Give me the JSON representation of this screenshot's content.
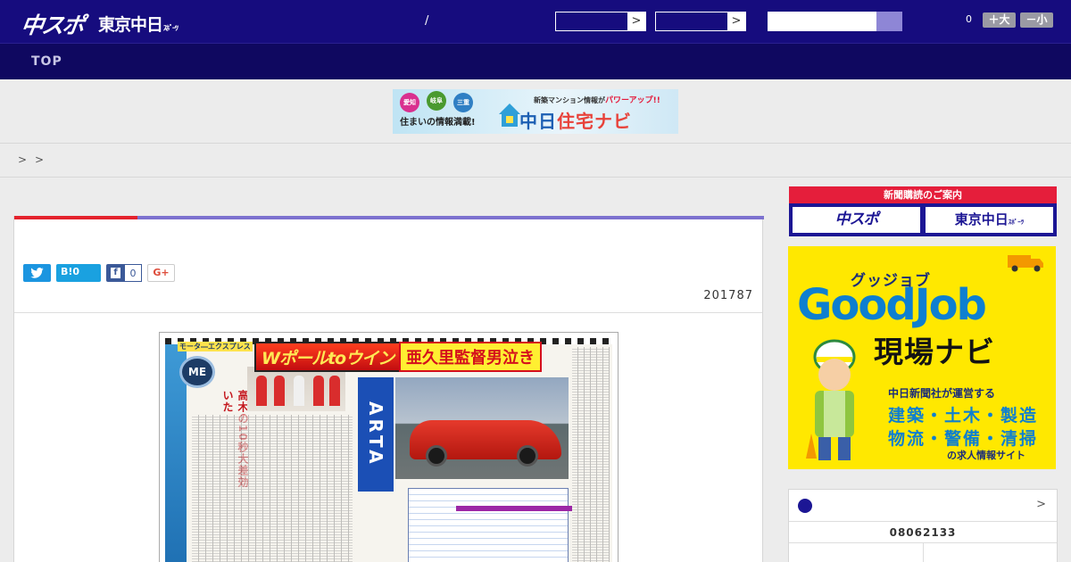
{
  "header": {
    "logo_chuspo": "中スポ",
    "logo_tokyo": "東京中日",
    "logo_tokyo_small": "ｽﾎﾟｰﾂ",
    "slash": "/",
    "select_arrow": ">",
    "font_size_count": "0",
    "size_up_label": "＋大",
    "size_down_label": "－小"
  },
  "nav": {
    "top_label": "TOP"
  },
  "banner": {
    "tag_1": "愛知",
    "tag_2": "岐阜",
    "tag_3": "三重",
    "subtext": "住まいの情報満載!",
    "headline": "新築マンション情報が",
    "headline_accent": "パワーアップ!!",
    "title_a": "中日",
    "title_b": "住宅ナビ"
  },
  "breadcrumb": {
    "sep_1": ">",
    "sep_2": ">"
  },
  "article": {
    "date": "201787",
    "share": {
      "hatena_label": "B!0",
      "facebook_icon": "f",
      "facebook_count": "0",
      "gplus_label": "G+"
    }
  },
  "newspaper": {
    "label": "モータ―エクスプレス",
    "logo": "ME",
    "headline_1": "Wポールtoウイン",
    "headline_2": "亜久里監督男泣き",
    "subhead": "高木の10秒大差効いた",
    "arta": "ARTA"
  },
  "sidebar": {
    "subscribe_head": "新聞購読のご案内",
    "subscribe_chuspo": "中スポ",
    "subscribe_tokyo": "東京中日",
    "subscribe_tokyo_small": "ｽﾎﾟｰﾂ",
    "goodjob": {
      "kana": "グッジョブ",
      "title": "GoodJob",
      "sub": "現場ナビ",
      "line_1": "中日新聞社が運営する",
      "line_2": "建築・土木・製造",
      "line_3": "物流・警備・清掃",
      "line_4": "の求人情報サイト"
    },
    "sports": {
      "more": ">",
      "date": "08062133"
    }
  },
  "colors": {
    "header_bg": "#160c7e",
    "nav_bg": "#0f0860",
    "accent_red": "#e4232d",
    "accent_purple": "#7d72cf",
    "goodjob_yellow": "#ffe800"
  }
}
